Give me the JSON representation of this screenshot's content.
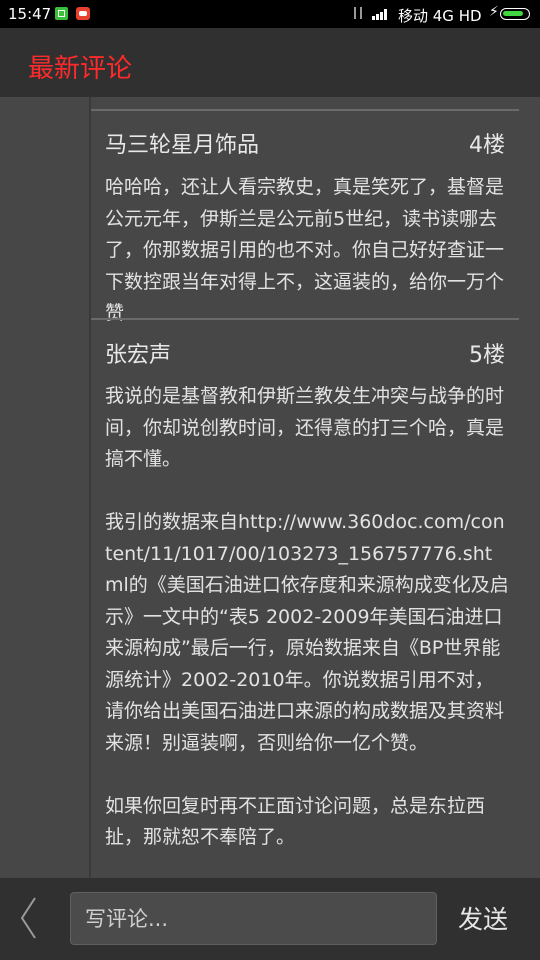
{
  "status_bar": {
    "time": "15:47",
    "carrier": "移动 4G HD",
    "icons": [
      "wechat-app-icon",
      "notification-app-icon",
      "network-transfer-icon",
      "signal-icon",
      "charging-icon",
      "battery-icon"
    ]
  },
  "header": {
    "title": "最新评论"
  },
  "comments": [
    {
      "author": "马三轮星月饰品",
      "floor": "4楼",
      "paragraphs": [
        "哈哈哈，还让人看宗教史，真是笑死了，基督是公元元年，伊斯兰是公元前5世纪，读书读哪去了，你那数据引用的也不对。你自己好好查证一下数控跟当年对得上不，这逼装的，给你一万个赞"
      ]
    },
    {
      "author": "张宏声",
      "floor": "5楼",
      "paragraphs": [
        "我说的是基督教和伊斯兰教发生冲突与战争的时间，你却说创教时间，还得意的打三个哈，真是搞不懂。",
        "我引的数据来自http://www.360doc.com/content/11/1017/00/103273_156757776.shtml的《美国石油进口依存度和来源构成变化及启示》一文中的“表5 2002-2009年美国石油进口来源构成”最后一行，原始数据来自《BP世界能源统计》2002-2010年。你说数据引用不对，请你给出美国石油进口来源的构成数据及其资料来源！别逼装啊，否则给你一亿个赞。",
        "如果你回复时再不正面讨论问题，总是东拉西扯，那就恕不奉陪了。"
      ]
    }
  ],
  "bottom_bar": {
    "input_placeholder": "写评论...",
    "send_label": "发送"
  },
  "colors": {
    "title_red": "#ff2a2a",
    "background": "#474747",
    "bar_background": "#303030"
  }
}
